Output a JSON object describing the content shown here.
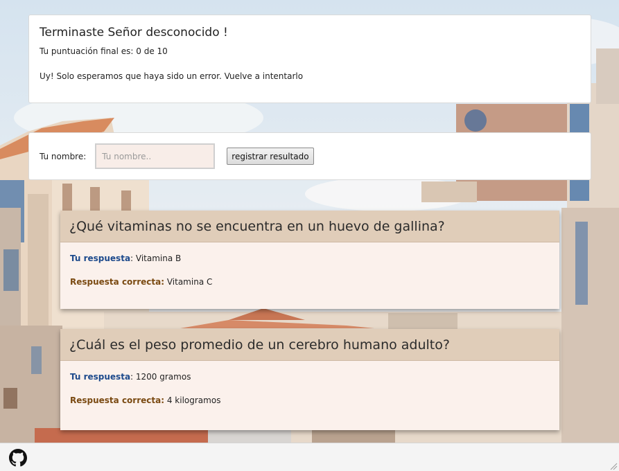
{
  "result": {
    "title": "Terminaste Señor desconocido !",
    "score_text": "Tu puntuación final es: 0 de 10",
    "message": "Uy! Solo esperamos que haya sido un error. Vuelve a intentarlo"
  },
  "register": {
    "label": "Tu nombre:",
    "input_placeholder": "Tu nombre..",
    "input_value": "",
    "button_label": "registrar resultado"
  },
  "questions": [
    {
      "question": "¿Qué vitaminas no se encuentra en un huevo de gallina?",
      "your_answer_label": "Tu respuesta",
      "your_answer": ": Vitamina B",
      "correct_label": "Respuesta correcta:",
      "correct_answer": " Vitamina C"
    },
    {
      "question": "¿Cuál es el peso promedio de un cerebro humano adulto?",
      "your_answer_label": "Tu respuesta",
      "your_answer": ": 1200 gramos",
      "correct_label": "Respuesta correcta:",
      "correct_answer": " 4 kilogramos"
    }
  ],
  "footer": {
    "github_icon": "github-icon"
  },
  "colors": {
    "question_header": "#e0cdb9",
    "qa_body": "#fbf1ec",
    "your_answer_label": "#1d4a8c",
    "correct_label": "#7a4a12",
    "input_bg": "#f8ede8"
  }
}
